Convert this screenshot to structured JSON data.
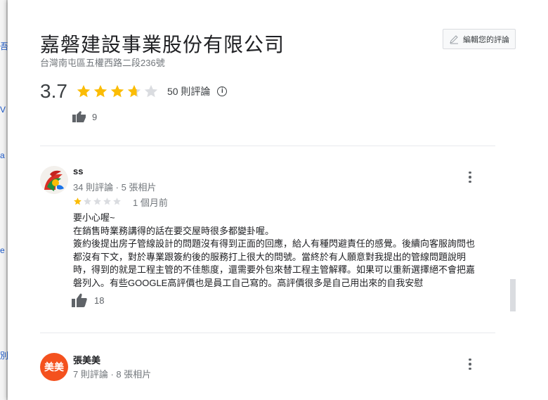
{
  "place": {
    "name": "嘉磐建設事業股份有限公司",
    "address": "台灣南屯區五權西路二段236號"
  },
  "edit_button": {
    "label": "編輯您的評論"
  },
  "rating": {
    "value": "3.7",
    "stars": 3.7,
    "count_label": "50 則評論"
  },
  "previous_review": {
    "likes": "9"
  },
  "reviews": [
    {
      "name": "ss",
      "meta": "34 則評論 · 5 張相片",
      "stars": 1,
      "time": "1 個月前",
      "text": "要小心喔~\n在銷售時業務講得的話在要交屋時很多都變卦喔。\n簽約後提出房子管線設計的問題沒有得到正面的回應，給人有種閃避責任的感覺。後續向客服詢問也都沒有下文，對於專業跟簽約後的服務打上很大的問號。當終於有人願意對我提出的管線問題說明時，得到的就是工程主管的不佳態度，還需要外包來替工程主管解釋。如果可以重新選擇絕不會把嘉磐列入。有些GOOGLE高評價也是員工自己寫的。高評價很多是自己用出來的自我安慰",
      "likes": "18"
    },
    {
      "name": "張美美",
      "meta": "7 則評論 · 8 張相片",
      "avatar_text": "美美"
    }
  ],
  "colors": {
    "star": "#fbbc04",
    "star_empty": "#dadce0",
    "avatar_orange": "#f4511e"
  }
}
